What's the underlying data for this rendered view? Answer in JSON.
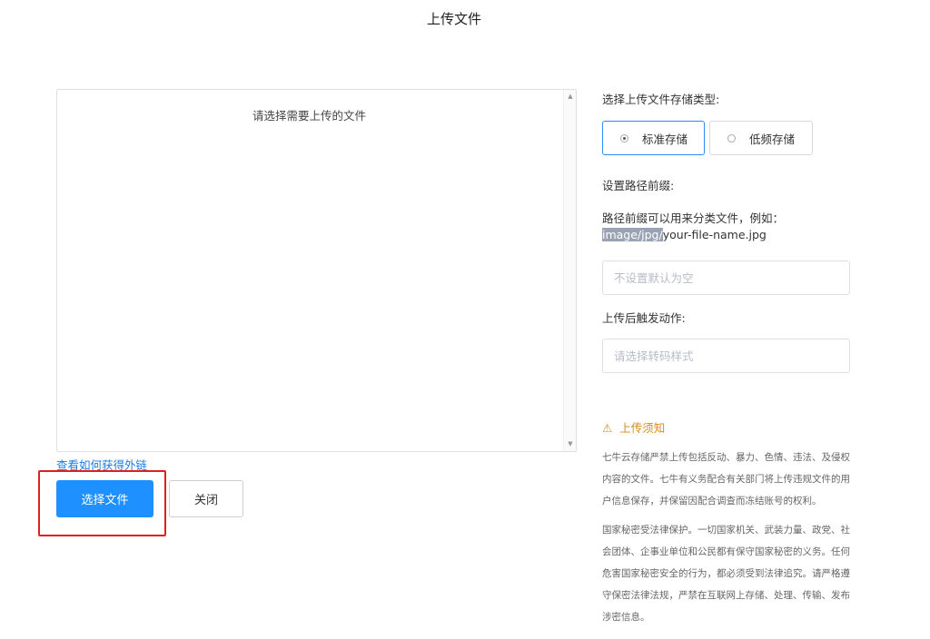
{
  "header": {
    "title": "上传文件"
  },
  "file_panel": {
    "placeholder": "请选择需要上传的文件",
    "link": "查看如何获得外链"
  },
  "buttons": {
    "select_file": "选择文件",
    "close": "关闭"
  },
  "storage": {
    "label": "选择上传文件存储类型:",
    "options": [
      {
        "label": "标准存储",
        "selected": true
      },
      {
        "label": "低频存储",
        "selected": false
      }
    ]
  },
  "prefix": {
    "label": "设置路径前缀:",
    "hint": "路径前缀可以用来分类文件，例如：",
    "example_highlight": "image/jpg/",
    "example_rest": "your-file-name.jpg",
    "placeholder": "不设置默认为空"
  },
  "trigger": {
    "label": "上传后触发动作:",
    "placeholder": "请选择转码样式"
  },
  "notice": {
    "title": "上传须知",
    "para1": "七牛云存储严禁上传包括反动、暴力、色情、违法、及侵权内容的文件。七牛有义务配合有关部门将上传违规文件的用户信息保存，并保留因配合调查而冻结账号的权利。",
    "para2": "国家秘密受法律保护。一切国家机关、武装力量、政党、社会团体、企事业单位和公民都有保守国家秘密的义务。任何危害国家秘密安全的行为，都必须受到法律追究。请严格遵守保密法律法规，严禁在互联网上存储、处理、传输、发布涉密信息。"
  },
  "colors": {
    "primary": "#1e90ff",
    "link": "#1b7be3",
    "warning": "#d98b1a",
    "highlight_box": "#e02020"
  }
}
